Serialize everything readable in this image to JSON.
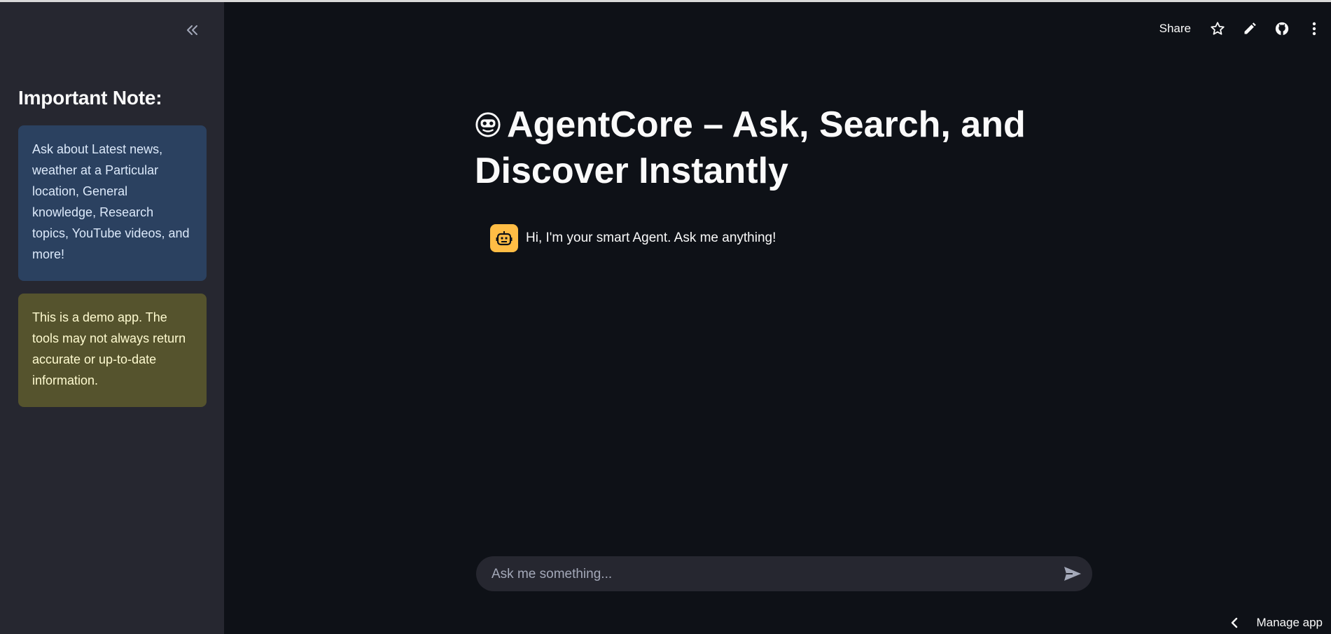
{
  "colors": {
    "background": "#0e1117",
    "sidebar": "#262730",
    "info_box": "#2b4160",
    "warning_box": "#55532d",
    "avatar": "#ffbd45"
  },
  "sidebar": {
    "collapse_icon": "double-chevron-left-icon",
    "title": "Important Note:",
    "info_note": "Ask about Latest news, weather at a Particular location, General knowledge, Research topics, YouTube videos, and more!",
    "warning_note": "This is a demo app. The tools may not always return accurate or up-to-date information."
  },
  "header": {
    "share_label": "Share",
    "icons": [
      "star-icon",
      "pencil-icon",
      "github-icon",
      "more-vertical-icon"
    ]
  },
  "main": {
    "title": "AgentCore – Ask, Search, and Discover Instantly",
    "title_icon": "robot-face-emoji-icon",
    "messages": [
      {
        "role": "assistant",
        "avatar_icon": "bot-icon",
        "text": "Hi, I'm your smart Agent. Ask me anything!"
      }
    ]
  },
  "chat_input": {
    "placeholder": "Ask me something...",
    "value": "",
    "send_icon": "send-icon"
  },
  "footer": {
    "manage_app_label": "Manage app",
    "manage_icon": "chevron-left-icon"
  }
}
